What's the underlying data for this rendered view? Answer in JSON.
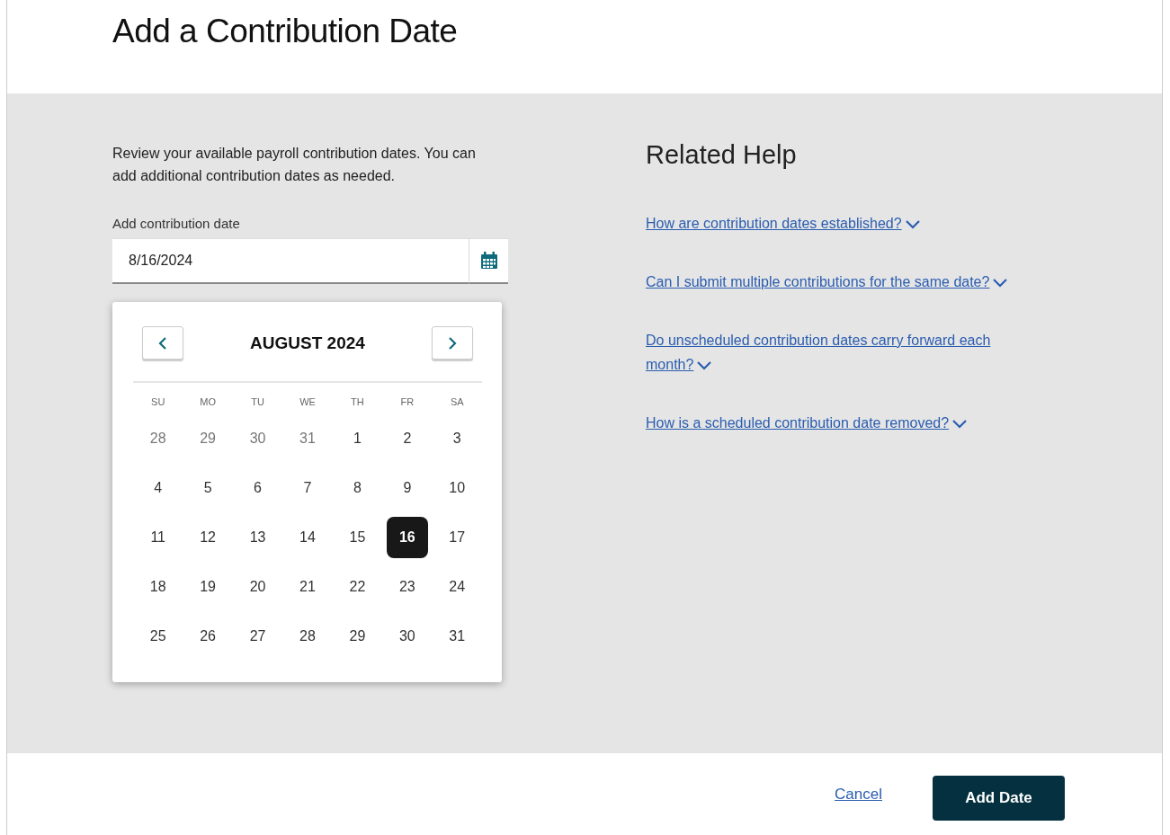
{
  "page": {
    "title": "Add a Contribution Date"
  },
  "intro": "Review your available payroll contribution dates. You can add additional contribution dates as needed.",
  "date_field": {
    "label": "Add contribution date",
    "value": "8/16/2024"
  },
  "calendar": {
    "month": "AUGUST 2024",
    "weekdays": [
      "SU",
      "MO",
      "TU",
      "WE",
      "TH",
      "FR",
      "SA"
    ],
    "days": [
      {
        "label": "28",
        "outside": true,
        "selected": false
      },
      {
        "label": "29",
        "outside": true,
        "selected": false
      },
      {
        "label": "30",
        "outside": true,
        "selected": false
      },
      {
        "label": "31",
        "outside": true,
        "selected": false
      },
      {
        "label": "1",
        "outside": false,
        "selected": false
      },
      {
        "label": "2",
        "outside": false,
        "selected": false
      },
      {
        "label": "3",
        "outside": false,
        "selected": false
      },
      {
        "label": "4",
        "outside": false,
        "selected": false
      },
      {
        "label": "5",
        "outside": false,
        "selected": false
      },
      {
        "label": "6",
        "outside": false,
        "selected": false
      },
      {
        "label": "7",
        "outside": false,
        "selected": false
      },
      {
        "label": "8",
        "outside": false,
        "selected": false
      },
      {
        "label": "9",
        "outside": false,
        "selected": false
      },
      {
        "label": "10",
        "outside": false,
        "selected": false
      },
      {
        "label": "11",
        "outside": false,
        "selected": false
      },
      {
        "label": "12",
        "outside": false,
        "selected": false
      },
      {
        "label": "13",
        "outside": false,
        "selected": false
      },
      {
        "label": "14",
        "outside": false,
        "selected": false
      },
      {
        "label": "15",
        "outside": false,
        "selected": false
      },
      {
        "label": "16",
        "outside": false,
        "selected": true
      },
      {
        "label": "17",
        "outside": false,
        "selected": false
      },
      {
        "label": "18",
        "outside": false,
        "selected": false
      },
      {
        "label": "19",
        "outside": false,
        "selected": false
      },
      {
        "label": "20",
        "outside": false,
        "selected": false
      },
      {
        "label": "21",
        "outside": false,
        "selected": false
      },
      {
        "label": "22",
        "outside": false,
        "selected": false
      },
      {
        "label": "23",
        "outside": false,
        "selected": false
      },
      {
        "label": "24",
        "outside": false,
        "selected": false
      },
      {
        "label": "25",
        "outside": false,
        "selected": false
      },
      {
        "label": "26",
        "outside": false,
        "selected": false
      },
      {
        "label": "27",
        "outside": false,
        "selected": false
      },
      {
        "label": "28",
        "outside": false,
        "selected": false
      },
      {
        "label": "29",
        "outside": false,
        "selected": false
      },
      {
        "label": "30",
        "outside": false,
        "selected": false
      },
      {
        "label": "31",
        "outside": false,
        "selected": false
      }
    ]
  },
  "related_help": {
    "title": "Related Help",
    "links": [
      {
        "text": "How are contribution dates established?",
        "expanded": false
      },
      {
        "text": "Can I submit multiple contributions for the same date?",
        "expanded": false
      },
      {
        "text": "Do unscheduled contribution dates carry forward each month?",
        "expanded": false
      },
      {
        "text": "How is a scheduled contribution date removed?",
        "expanded": false
      }
    ]
  },
  "footer": {
    "cancel": "Cancel",
    "submit": "Add Date"
  }
}
